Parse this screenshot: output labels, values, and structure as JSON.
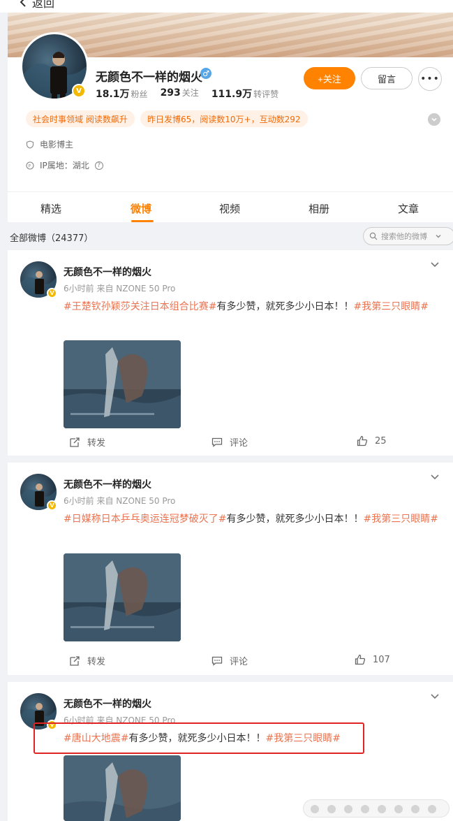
{
  "nav": {
    "back_label": "返回"
  },
  "profile": {
    "name": "无颜色不一样的烟火",
    "gender_symbol": "♂",
    "verified_badge": "V",
    "stats": [
      {
        "value": "18.1万",
        "unit": "粉丝"
      },
      {
        "value": "293",
        "unit": "关注"
      },
      {
        "value": "111.9万",
        "unit": "转评赞"
      }
    ],
    "follow_label": "+关注",
    "message_label": "留言",
    "more_label": "•••",
    "tags": [
      "社会时事领域 阅读数飙升",
      "昨日发博65，阅读数10万+，互动数292"
    ],
    "role": "电影博主",
    "ip_location": "IP属地：湖北",
    "help_icon": "?",
    "expand_icon": "chevron-down-icon"
  },
  "tabs": [
    "精选",
    "微博",
    "视频",
    "相册",
    "文章"
  ],
  "active_tab_index": 1,
  "feed_header": {
    "label": "全部微博（24377）",
    "search_placeholder": "搜索他的微博"
  },
  "posts": [
    {
      "author": "无颜色不一样的烟火",
      "meta": "6小时前  来自 NZONE 50 Pro",
      "topic1": "#王楚钦孙颖莎关注日本组合比赛#",
      "text": "有多少赞，就死多少小日本！！",
      "topic2": "#我第三只眼睛#",
      "repost_label": "转发",
      "comment_label": "评论",
      "likes": "25"
    },
    {
      "author": "无颜色不一样的烟火",
      "meta": "6小时前  来自 NZONE 50 Pro",
      "topic1": "#日媒称日本乒乓奥运连冠梦破灭了#",
      "text": "有多少赞，就死多少小日本！！",
      "topic2": "#我第三只眼睛#",
      "repost_label": "转发",
      "comment_label": "评论",
      "likes": "107"
    },
    {
      "author": "无颜色不一样的烟火",
      "meta": "6小时前  来自 NZONE 50 Pro",
      "topic1": "#唐山大地震#",
      "text": "有多少赞，就死多少小日本！！",
      "topic2": "#我第三只眼睛#"
    }
  ],
  "colors": {
    "accent": "#ff8200",
    "topic": "#eb7350",
    "highlight_box": "#e02424",
    "verified": "#f5b800"
  }
}
